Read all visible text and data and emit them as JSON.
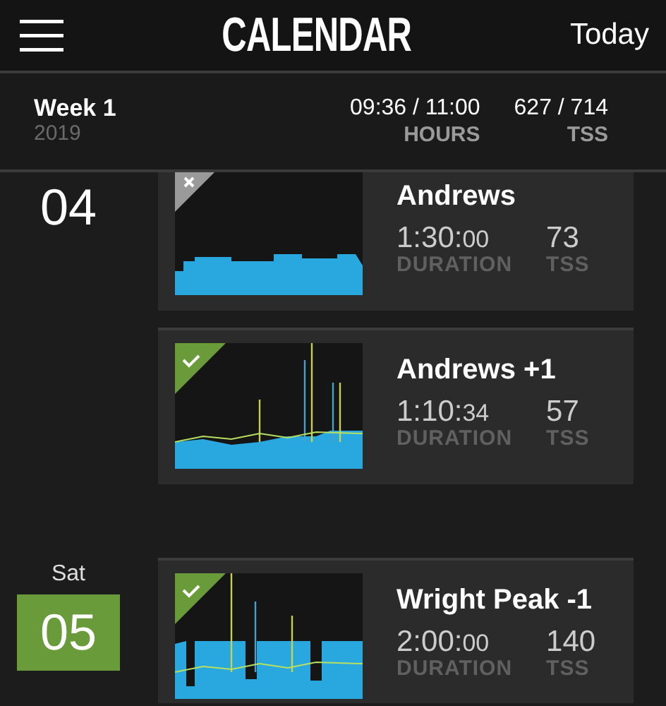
{
  "header": {
    "title": "CALENDAR",
    "today_button": "Today"
  },
  "week": {
    "label": "Week 1",
    "year": "2019",
    "hours_value": "09:36 / 11:00",
    "hours_label": "HOURS",
    "tss_value": "627 / 714",
    "tss_label": "TSS"
  },
  "days": [
    {
      "number": "04",
      "selected": false,
      "workouts": [
        {
          "name": "Andrews",
          "completed": false,
          "duration_main": "1:30:",
          "duration_seconds": "00",
          "duration_label": "DURATION",
          "tss": "73",
          "tss_label": "TSS"
        },
        {
          "name": "Andrews +1",
          "completed": true,
          "duration_main": "1:10:",
          "duration_seconds": "34",
          "duration_label": "DURATION",
          "tss": "57",
          "tss_label": "TSS"
        }
      ]
    },
    {
      "weekday": "Sat",
      "number": "05",
      "selected": true,
      "workouts": [
        {
          "name": "Wright Peak -1",
          "completed": true,
          "duration_main": "2:00:",
          "duration_seconds": "00",
          "duration_label": "DURATION",
          "tss": "140",
          "tss_label": "TSS"
        }
      ]
    }
  ]
}
